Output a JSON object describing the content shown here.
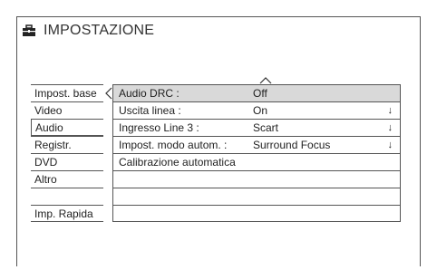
{
  "title": "IMPOSTAZIONE",
  "icons": {
    "title": "toolbox-icon",
    "cursor_left": "chevron-left-icon",
    "cursor_up": "chevron-up-icon",
    "dropdown": "down-arrow-icon"
  },
  "categories": [
    "Impost. base",
    "Video",
    "Audio",
    "Registr.",
    "DVD",
    "Altro",
    "",
    "Imp. Rapida"
  ],
  "selected_category": "Audio",
  "settings": [
    {
      "label": "Audio DRC :",
      "value": "Off",
      "has_arrow": false,
      "highlighted": true
    },
    {
      "label": "Uscita linea :",
      "value": "On",
      "has_arrow": true,
      "highlighted": false
    },
    {
      "label": "Ingresso Line 3 :",
      "value": "Scart",
      "has_arrow": true,
      "highlighted": false
    },
    {
      "label": "Impost. modo autom. :",
      "value": "Surround Focus",
      "has_arrow": true,
      "highlighted": false
    },
    {
      "label": "Calibrazione automatica",
      "value": "",
      "has_arrow": false,
      "highlighted": false
    },
    {
      "label": "",
      "value": "",
      "has_arrow": false,
      "highlighted": false
    },
    {
      "label": "",
      "value": "",
      "has_arrow": false,
      "highlighted": false
    },
    {
      "label": "",
      "value": "",
      "has_arrow": false,
      "highlighted": false
    }
  ],
  "dropdown_arrow": "↓",
  "colors": {
    "highlight": "#d9d9d9",
    "border": "#555555"
  }
}
